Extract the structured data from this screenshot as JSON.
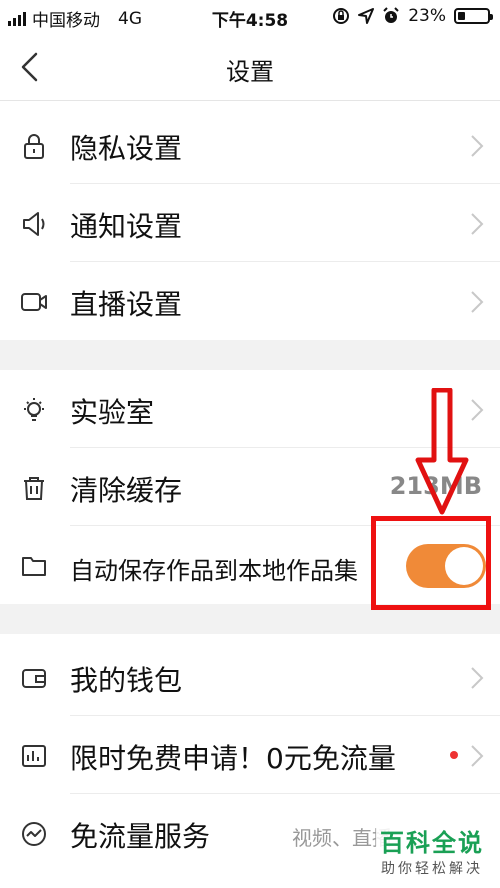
{
  "status_bar": {
    "carrier": "中国移动",
    "network": "4G",
    "time": "下午4:58",
    "battery": "23%",
    "battery_level": 0.23
  },
  "nav": {
    "title": "设置",
    "back_icon": "chevron-left-icon"
  },
  "section1": [
    {
      "label": "隐私设置",
      "icon": "lock-icon"
    },
    {
      "label": "通知设置",
      "icon": "speaker-icon"
    },
    {
      "label": "直播设置",
      "icon": "video-camera-icon"
    }
  ],
  "section2": {
    "lab": {
      "label": "实验室",
      "icon": "lightbulb-icon"
    },
    "cache": {
      "label": "清除缓存",
      "icon": "trash-icon",
      "value": "213MB"
    },
    "autosave": {
      "label": "自动保存作品到本地作品集",
      "icon": "folder-icon",
      "toggle_on": true,
      "toggle_color": "#f08a38"
    }
  },
  "section3": {
    "wallet": {
      "label": "我的钱包",
      "icon": "wallet-icon"
    },
    "free_apply": {
      "label": "限时免费申请！0元免流量",
      "icon": "chart-icon",
      "badge": "red-dot"
    },
    "traffic": {
      "label": "免流量服务",
      "icon": "activity-icon",
      "sub": "视频、直播"
    }
  },
  "annotation": {
    "arrow_color": "#e11111",
    "box_color": "#e11111"
  },
  "watermark": {
    "title": "百科全说",
    "subtitle": "助你轻松解决"
  }
}
